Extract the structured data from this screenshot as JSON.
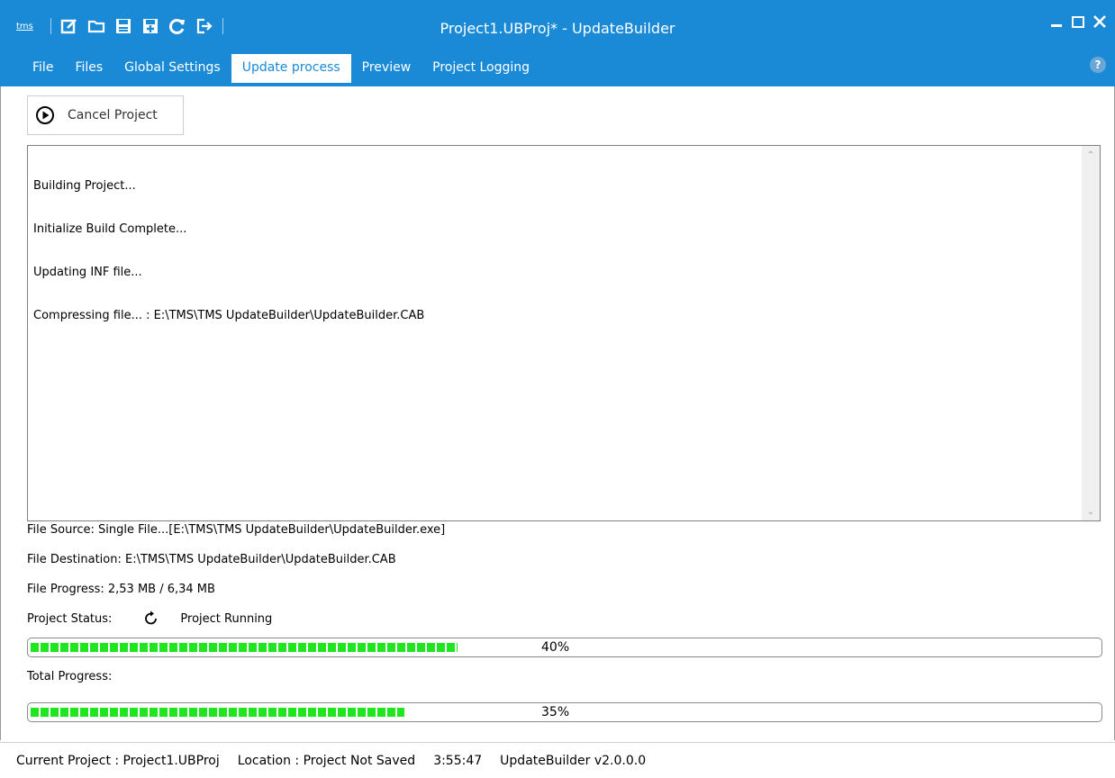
{
  "window": {
    "title": "Project1.UBProj* - UpdateBuilder",
    "app_logo": "tms",
    "quick_access_icons": [
      "new-icon",
      "open-folder-icon",
      "save-icon",
      "save-as-icon",
      "refresh-icon",
      "exit-icon"
    ],
    "controls": [
      "minimize-icon",
      "maximize-icon",
      "close-icon"
    ]
  },
  "tabs": [
    {
      "label": "File"
    },
    {
      "label": "Files"
    },
    {
      "label": "Global Settings"
    },
    {
      "label": "Update process",
      "active": true
    },
    {
      "label": "Preview"
    },
    {
      "label": "Project Logging"
    }
  ],
  "help_label": "?",
  "cancel_button": {
    "label": "Cancel Project",
    "icon": "play-circle-icon"
  },
  "log": {
    "lines": [
      "Building Project...",
      "Initialize Build Complete...",
      "Updating INF file...",
      "Compressing file... : E:\\TMS\\TMS UpdateBuilder\\UpdateBuilder.CAB"
    ]
  },
  "file_source": "File Source: Single File...[E:\\TMS\\TMS UpdateBuilder\\UpdateBuilder.exe]",
  "file_destination": "File Destination: E:\\TMS\\TMS UpdateBuilder\\UpdateBuilder.CAB",
  "file_progress": "File Progress: 2,53 MB / 6,34 MB",
  "project_status": {
    "label": "Project Status:",
    "icon": "refresh-icon",
    "value": "Project Running"
  },
  "file_progress_bar": {
    "percent_label": "40%",
    "fill_fraction": 0.4
  },
  "total_progress": {
    "label": "Total Progress:",
    "percent_label": "35%",
    "fill_fraction": 0.35
  },
  "statusbar": {
    "current_project": "Current Project : Project1.UBProj",
    "location": "Location : Project Not Saved",
    "time": "3:55:47",
    "version": "UpdateBuilder v2.0.0.0"
  },
  "colors": {
    "accent": "#1b8ad6",
    "progress": "#1fe61f"
  }
}
